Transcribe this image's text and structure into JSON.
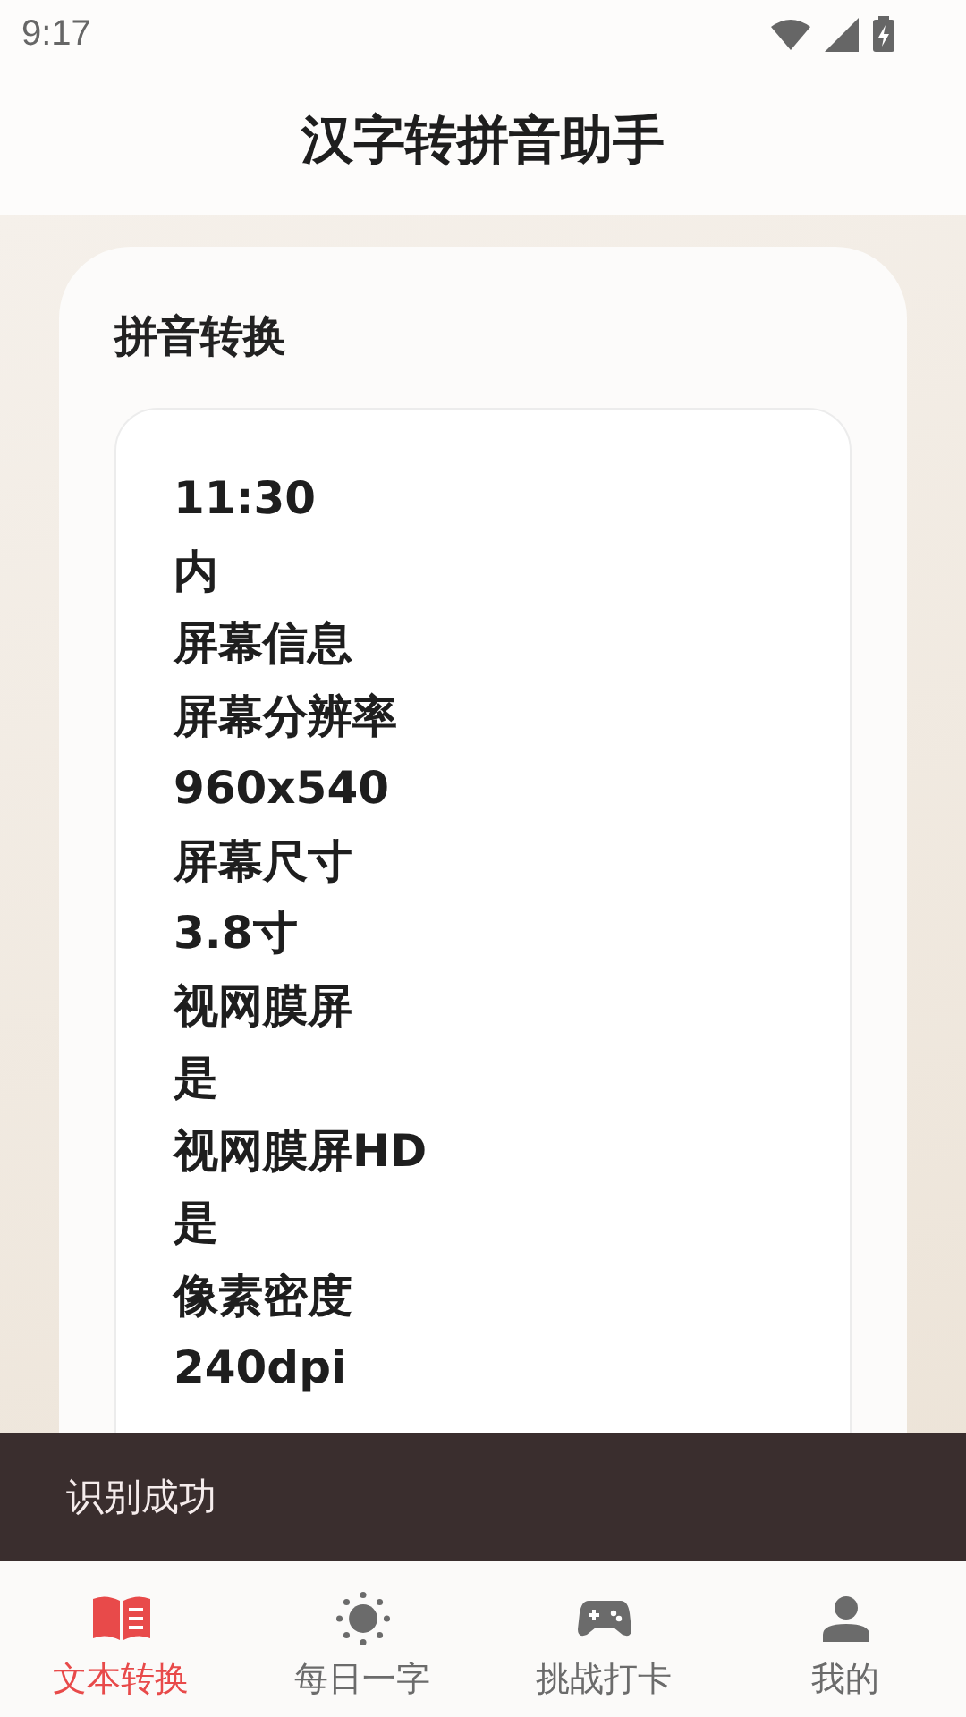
{
  "status_bar": {
    "time": "9:17"
  },
  "header": {
    "title": "汉字转拼音助手"
  },
  "card": {
    "title": "拼音转换",
    "lines": [
      "11:30",
      "内",
      "屏幕信息",
      "屏幕分辨率",
      "960x540",
      "屏幕尺寸",
      "3.8寸",
      "视网膜屏",
      "是",
      "视网膜屏HD",
      "是",
      "像素密度",
      "240dpi"
    ]
  },
  "toast": {
    "text": "识别成功"
  },
  "bottom_nav": [
    {
      "label": "文本转换",
      "kind": "book",
      "selected": true
    },
    {
      "label": "每日一字",
      "kind": "sun",
      "selected": false
    },
    {
      "label": "挑战打卡",
      "kind": "gamepad",
      "selected": false
    },
    {
      "label": "我的",
      "kind": "person",
      "selected": false
    }
  ]
}
